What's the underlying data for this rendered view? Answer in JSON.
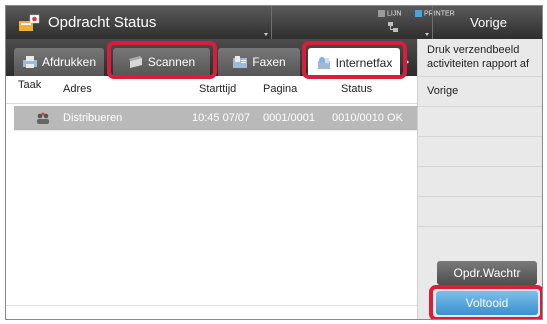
{
  "header": {
    "title": "Opdracht Status",
    "lijn_label": "LIJN",
    "printer_label": "PRINTER",
    "vorige_label": "Vorige"
  },
  "tabs": [
    {
      "label": "Afdrukken",
      "icon": "printer-icon",
      "selected": false
    },
    {
      "label": "Scannen",
      "icon": "scanner-icon",
      "selected": false
    },
    {
      "label": "Faxen",
      "icon": "fax-icon",
      "selected": false
    },
    {
      "label": "Internetfax",
      "icon": "internet-fax-icon",
      "selected": true
    }
  ],
  "table": {
    "columns": [
      "Taak",
      "Adres",
      "Starttijd",
      "Pagina",
      "Status"
    ],
    "rows": [
      {
        "icon": "broadcast-icon",
        "adres": "Distribueren",
        "starttijd": "10:45 07/07",
        "pagina": "0001/0001",
        "status": "0010/0010 OK"
      }
    ]
  },
  "right_panel": {
    "druk_label": "Druk verzendbeeld activiteiten rapport af",
    "vorige_label": "Vorige",
    "opdr_wachtr_label": "Opdr.Wachtr",
    "voltooid_label": "Voltooid"
  },
  "colors": {
    "highlight": "#d81e3a",
    "accent_blue": "#3b8fd0",
    "header_dark": "#2e2e2e"
  }
}
